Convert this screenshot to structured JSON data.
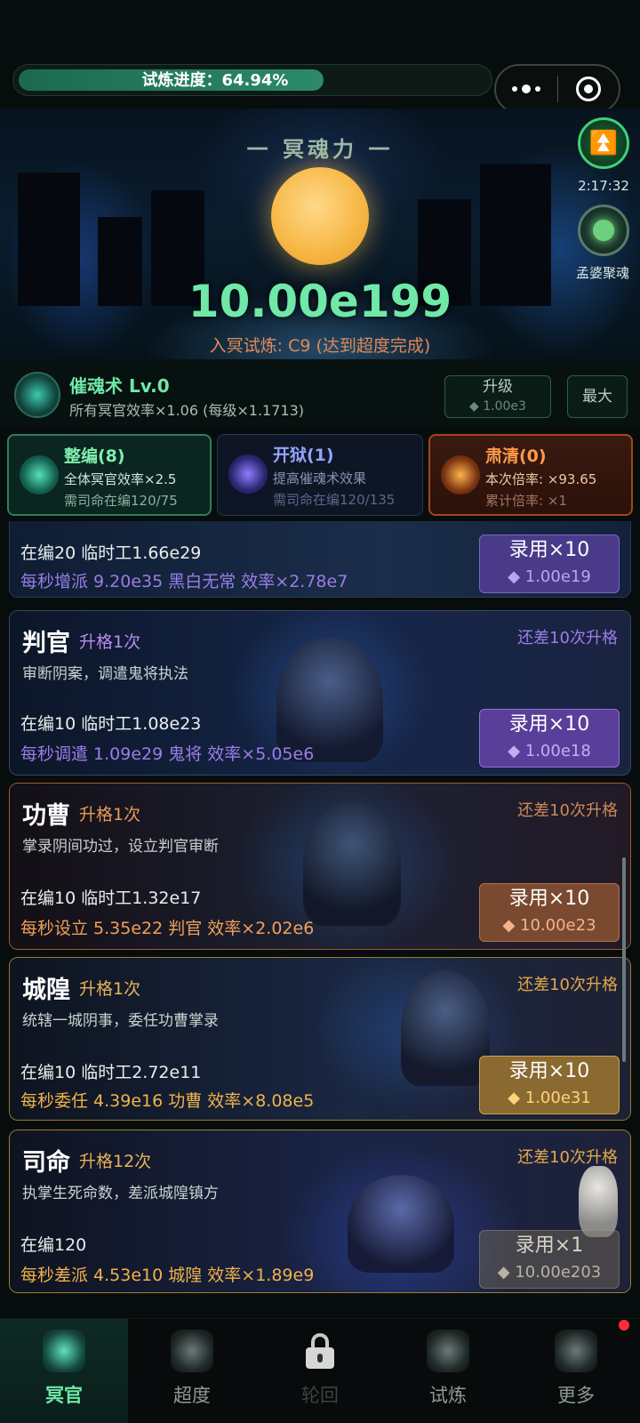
{
  "progress": {
    "label": "试炼进度：64.94%",
    "percent": 64.94
  },
  "hero": {
    "title": "一 冥魂力 一",
    "value": "10.00e199",
    "subtitle": "入冥试炼: C9 (达到超度完成)"
  },
  "side": {
    "timer": "2:17:32",
    "meng_label": "孟婆聚魂"
  },
  "skill": {
    "name": "催魂术 Lv.0",
    "desc": "所有冥官效率×1.06 (每级×1.1713)",
    "upgrade_label": "升级",
    "upgrade_cost": "◆ 1.00e3",
    "max_label": "最大"
  },
  "cards": [
    {
      "title": "整编(8)",
      "line1": "全体冥官效率×2.5",
      "line2": "需司命在编120/75"
    },
    {
      "title": "开狱(1)",
      "line1": "提高催魂术效果",
      "line2": "需司命在编120/135"
    },
    {
      "title": "肃清(0)",
      "line1": "本次倍率: ×93.65",
      "line2": "累计倍率: ×1"
    }
  ],
  "units": [
    {
      "name": "",
      "rank": "",
      "desc": "",
      "need": "",
      "staff": "在编20  临时工1.66e29",
      "rate": "每秒增派 9.20e35 黑白无常  效率×2.78e7",
      "hire": "录用×10",
      "cost": "◆ 1.00e19"
    },
    {
      "name": "判官",
      "rank": "升格1次",
      "desc": "审断阴案，调遣鬼将执法",
      "need": "还差10次升格",
      "staff": "在编10  临时工1.08e23",
      "rate": "每秒调遣 1.09e29 鬼将  效率×5.05e6",
      "hire": "录用×10",
      "cost": "◆ 1.00e18"
    },
    {
      "name": "功曹",
      "rank": "升格1次",
      "desc": "掌录阴间功过，设立判官审断",
      "need": "还差10次升格",
      "staff": "在编10  临时工1.32e17",
      "rate": "每秒设立 5.35e22 判官  效率×2.02e6",
      "hire": "录用×10",
      "cost": "◆ 10.00e23"
    },
    {
      "name": "城隍",
      "rank": "升格1次",
      "desc": "统辖一城阴事，委任功曹掌录",
      "need": "还差10次升格",
      "staff": "在编10  临时工2.72e11",
      "rate": "每秒委任 4.39e16 功曹  效率×8.08e5",
      "hire": "录用×10",
      "cost": "◆ 1.00e31"
    },
    {
      "name": "司命",
      "rank": "升格12次",
      "desc": "执掌生死命数，差派城隍镇方",
      "need": "还差10次升格",
      "staff": "在编120",
      "rate": "每秒差派 4.53e10 城隍  效率×1.89e9",
      "hire": "录用×1",
      "cost": "◆ 10.00e203"
    }
  ],
  "nav": [
    {
      "label": "冥官"
    },
    {
      "label": "超度"
    },
    {
      "label": "轮回"
    },
    {
      "label": "试炼"
    },
    {
      "label": "更多"
    }
  ],
  "colors": {
    "accent": "#6fe8a8",
    "gold": "#f7b949",
    "orange": "#ff9a4a",
    "purple": "#9a7de8"
  }
}
